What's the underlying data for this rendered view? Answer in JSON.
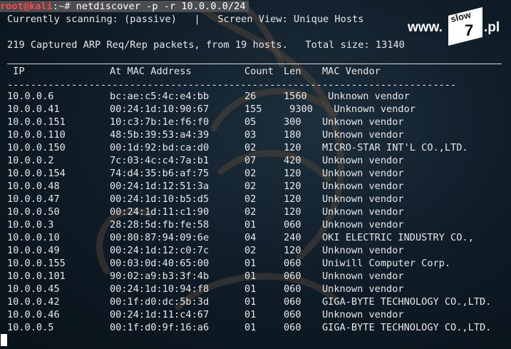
{
  "prompt": {
    "user_host": "root@kali",
    "path": ":~#",
    "command": " netdiscover -p -r 10.0.0.0/24"
  },
  "status": {
    "scanning": "Currently scanning: (passive)   |   Screen View: Unique Hosts",
    "captured": "219 Captured ARP Req/Rep packets, from 19 hosts.   Total size: 13140"
  },
  "headers": {
    "ip": " IP",
    "mac": "At MAC Address",
    "count": "Count",
    "len": "Len",
    "vendor": "MAC Vendor"
  },
  "dashes": "-----------------------------------------------------------------------------",
  "rows": [
    {
      "ip": "10.0.0.6",
      "mac": "bc:ae:c5:4c:e4:bb",
      "count": "26",
      "len": "1560",
      "vendor": " Unknown vendor"
    },
    {
      "ip": "10.0.0.41",
      "mac": "00:24:1d:10:90:67",
      "count": "155",
      "len": " 9300",
      "vendor": "  Unknown vendor"
    },
    {
      "ip": "10.0.0.151",
      "mac": "10:c3:7b:1e:f6:f0",
      "count": "05",
      "len": "300",
      "vendor": "Unknown vendor"
    },
    {
      "ip": "10.0.0.110",
      "mac": "48:5b:39:53:a4:39",
      "count": "03",
      "len": "180",
      "vendor": "Unknown vendor"
    },
    {
      "ip": "10.0.0.150",
      "mac": "00:1d:92:bd:ca:d0",
      "count": "02",
      "len": "120",
      "vendor": "MICRO-STAR INT'L CO.,LTD."
    },
    {
      "ip": "10.0.0.2",
      "mac": "7c:03:4c:c4:7a:b1",
      "count": "07",
      "len": "420",
      "vendor": "Unknown vendor"
    },
    {
      "ip": "10.0.0.154",
      "mac": "74:d4:35:b6:af:75",
      "count": "02",
      "len": "120",
      "vendor": "Unknown vendor"
    },
    {
      "ip": "10.0.0.48",
      "mac": "00:24:1d:12:51:3a",
      "count": "02",
      "len": "120",
      "vendor": "Unknown vendor"
    },
    {
      "ip": "10.0.0.47",
      "mac": "00:24:1d:10:b5:d5",
      "count": "02",
      "len": "120",
      "vendor": "Unknown vendor"
    },
    {
      "ip": "10.0.0.50",
      "mac": "00:24:1d:11:c1:90",
      "count": "02",
      "len": "120",
      "vendor": "Unknown vendor"
    },
    {
      "ip": "10.0.0.3",
      "mac": "28:28:5d:fb:fe:58",
      "count": "01",
      "len": "060",
      "vendor": "Unknown vendor"
    },
    {
      "ip": "10.0.0.10",
      "mac": "00:80:87:94:09:6e",
      "count": "04",
      "len": "240",
      "vendor": "OKI ELECTRIC INDUSTRY CO.,"
    },
    {
      "ip": "10.0.0.49",
      "mac": "00:24:1d:12:c0:7c",
      "count": "02",
      "len": "120",
      "vendor": "Unknown vendor"
    },
    {
      "ip": "10.0.0.155",
      "mac": "00:03:0d:40:65:00",
      "count": "01",
      "len": "060",
      "vendor": "Uniwill Computer Corp."
    },
    {
      "ip": "10.0.0.101",
      "mac": "90:02:a9:b3:3f:4b",
      "count": "01",
      "len": "060",
      "vendor": "Unknown vendor"
    },
    {
      "ip": "10.0.0.45",
      "mac": "00:24:1d:10:94:f8",
      "count": "01",
      "len": "060",
      "vendor": "Unknown vendor"
    },
    {
      "ip": "10.0.0.42",
      "mac": "00:1f:d0:dc:5b:3d",
      "count": "01",
      "len": "060",
      "vendor": "GIGA-BYTE TECHNOLOGY CO.,LTD."
    },
    {
      "ip": "10.0.0.46",
      "mac": "00:24:1d:11:c4:67",
      "count": "01",
      "len": "060",
      "vendor": "Unknown vendor"
    },
    {
      "ip": "10.0.0.5",
      "mac": "00:1f:d0:9f:16:a6",
      "count": "01",
      "len": "060",
      "vendor": "GIGA-BYTE TECHNOLOGY CO.,LTD."
    }
  ],
  "logo": {
    "www": "www.",
    "slow": "slow",
    "seven": "7",
    "pl": ".pl"
  },
  "colors": {
    "background": "#0a1620",
    "text": "#e8e8e8",
    "prompt_user": "#ff4646",
    "prompt_bar": "#4b4d4f"
  }
}
